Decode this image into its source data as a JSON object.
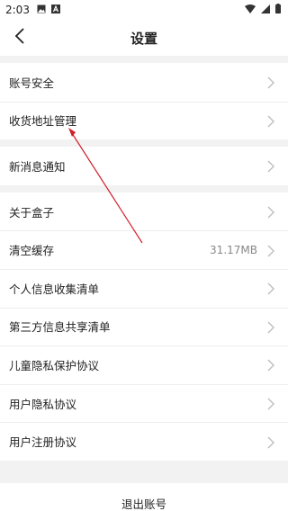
{
  "status_bar": {
    "time": "2:03",
    "icons": [
      "image-icon",
      "app-a-icon",
      "wifi-icon",
      "signal-icon",
      "battery-icon"
    ]
  },
  "header": {
    "back_icon": "chevron-left-icon",
    "title": "设置"
  },
  "groups": [
    {
      "items": [
        {
          "label": "账号安全"
        },
        {
          "label": "收货地址管理"
        }
      ]
    },
    {
      "items": [
        {
          "label": "新消息通知"
        }
      ]
    },
    {
      "items": [
        {
          "label": "关于盒子"
        },
        {
          "label": "清空缓存",
          "value": "31.17MB"
        },
        {
          "label": "个人信息收集清单"
        },
        {
          "label": "第三方信息共享清单"
        },
        {
          "label": "儿童隐私保护协议"
        },
        {
          "label": "用户隐私协议"
        },
        {
          "label": "用户注册协议"
        }
      ]
    }
  ],
  "logout": {
    "label": "退出账号"
  },
  "annotation": {
    "color": "#d0202a"
  }
}
